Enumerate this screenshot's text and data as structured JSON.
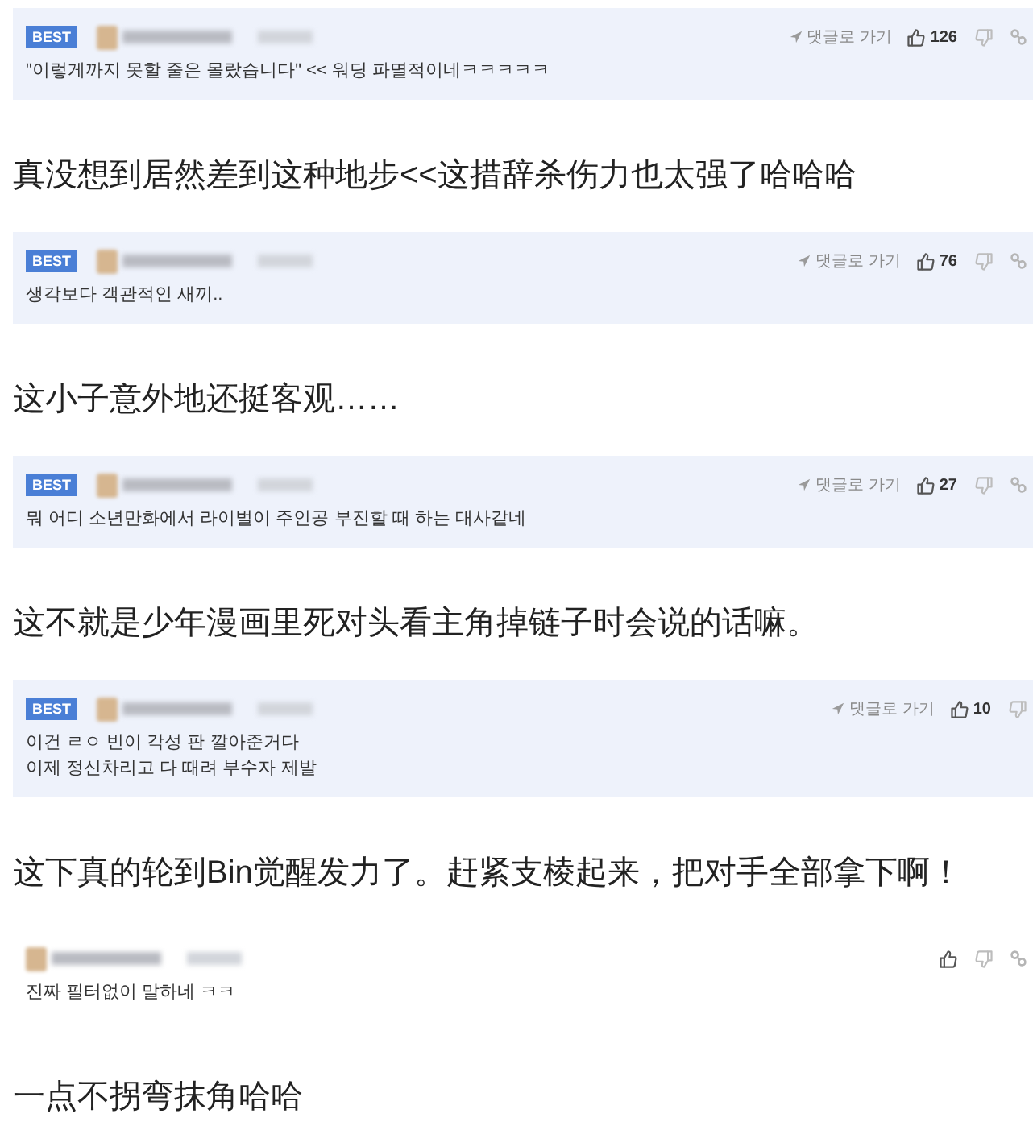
{
  "comments": [
    {
      "badge": "BEST",
      "actions": [
        {
          "kind": "reply_link",
          "label": "댓글로 가기"
        },
        {
          "kind": "like",
          "count": "126"
        },
        {
          "kind": "dislike"
        },
        {
          "kind": "share"
        }
      ],
      "lines": [
        "\"이렇게까지 못할 줄은 몰랐습니다\" << 워딩 파멸적이네ㅋㅋㅋㅋㅋ"
      ],
      "translation": "真没想到居然差到这种地步<<这措辞杀伤力也太强了哈哈哈"
    },
    {
      "badge": "BEST",
      "actions": [
        {
          "kind": "reply_link",
          "label": "댓글로 가기"
        },
        {
          "kind": "like",
          "count": "76"
        },
        {
          "kind": "dislike"
        },
        {
          "kind": "share"
        }
      ],
      "lines": [
        "생각보다 객관적인 새끼.."
      ],
      "translation": "这小子意外地还挺客观……"
    },
    {
      "badge": "BEST",
      "actions": [
        {
          "kind": "reply_link",
          "label": "댓글로 가기"
        },
        {
          "kind": "like",
          "count": "27"
        },
        {
          "kind": "dislike"
        },
        {
          "kind": "share"
        }
      ],
      "lines": [
        "뭐 어디 소년만화에서 라이벌이 주인공 부진할 때 하는 대사같네"
      ],
      "translation": "这不就是少年漫画里死对头看主角掉链子时会说的话嘛。"
    },
    {
      "badge": "BEST",
      "actions": [
        {
          "kind": "reply_link",
          "label": "댓글로 가기"
        },
        {
          "kind": "like",
          "count": "10"
        },
        {
          "kind": "dislike"
        }
      ],
      "lines": [
        "이건 ㄹㅇ 빈이 각성 판 깔아준거다",
        "이제 정신차리고 다 때려 부수자 제발"
      ],
      "translation": "这下真的轮到Bin觉醒发力了。赶紧支棱起来，把对手全部拿下啊！"
    },
    {
      "actions": [
        {
          "kind": "like"
        },
        {
          "kind": "dislike"
        },
        {
          "kind": "share"
        }
      ],
      "lines": [
        "진짜 필터없이 말하네 ㅋㅋ"
      ],
      "translation": "一点不拐弯抹角哈哈"
    }
  ]
}
